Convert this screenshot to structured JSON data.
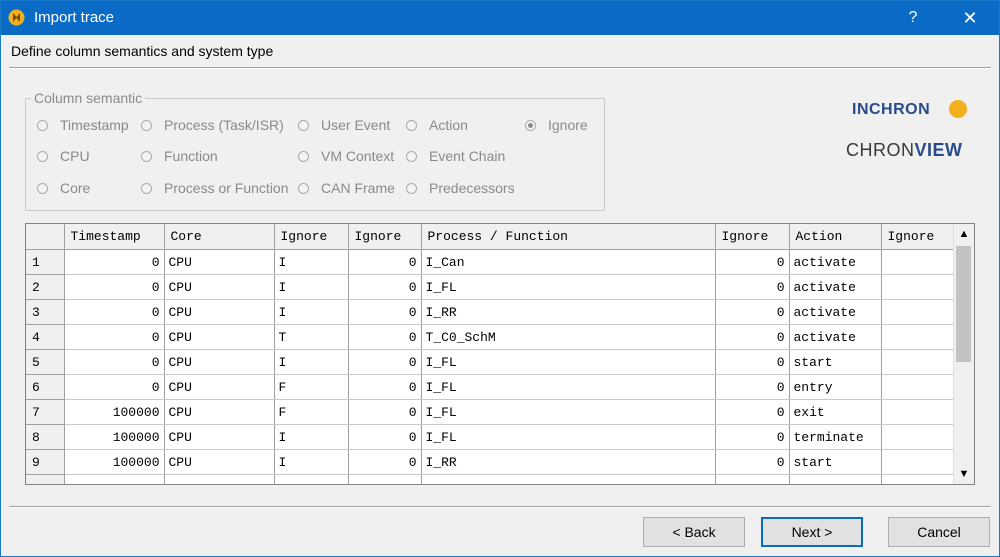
{
  "window": {
    "title": "Import trace",
    "help": "?",
    "close": "✕",
    "icon": "inchron-app-icon"
  },
  "subtitle": "Define column semantics and system type",
  "column_semantic": {
    "legend": "Column semantic",
    "options": [
      {
        "label": "Timestamp",
        "checked": false
      },
      {
        "label": "Process (Task/ISR)",
        "checked": false
      },
      {
        "label": "User Event",
        "checked": false
      },
      {
        "label": "Action",
        "checked": false
      },
      {
        "label": "Ignore",
        "checked": true
      },
      {
        "label": "CPU",
        "checked": false
      },
      {
        "label": "Function",
        "checked": false
      },
      {
        "label": "VM Context",
        "checked": false
      },
      {
        "label": "Event Chain",
        "checked": false
      },
      {
        "label": "Core",
        "checked": false
      },
      {
        "label": "Process or Function",
        "checked": false
      },
      {
        "label": "CAN Frame",
        "checked": false
      },
      {
        "label": "Predecessors",
        "checked": false
      }
    ]
  },
  "logos": {
    "inchron": "INCHRON",
    "chron": "CHRON",
    "view": "VIEW",
    "brand_color": "#2a4a8a",
    "mark_color": "#f2b01e"
  },
  "table": {
    "headers": [
      "Timestamp",
      "Core",
      "Ignore",
      "Ignore",
      "Process / Function",
      "Ignore",
      "Action",
      "Ignore"
    ],
    "rows": [
      [
        "1",
        "0",
        "CPU",
        "I",
        "0",
        "I_Can",
        "0",
        "activate",
        ""
      ],
      [
        "2",
        "0",
        "CPU",
        "I",
        "0",
        "I_FL",
        "0",
        "activate",
        ""
      ],
      [
        "3",
        "0",
        "CPU",
        "I",
        "0",
        "I_RR",
        "0",
        "activate",
        ""
      ],
      [
        "4",
        "0",
        "CPU",
        "T",
        "0",
        "T_C0_SchM",
        "0",
        "activate",
        ""
      ],
      [
        "5",
        "0",
        "CPU",
        "I",
        "0",
        "I_FL",
        "0",
        "start",
        ""
      ],
      [
        "6",
        "0",
        "CPU",
        "F",
        "0",
        "I_FL",
        "0",
        "entry",
        ""
      ],
      [
        "7",
        "100000",
        "CPU",
        "F",
        "0",
        "I_FL",
        "0",
        "exit",
        ""
      ],
      [
        "8",
        "100000",
        "CPU",
        "I",
        "0",
        "I_FL",
        "0",
        "terminate",
        ""
      ],
      [
        "9",
        "100000",
        "CPU",
        "I",
        "0",
        "I_RR",
        "0",
        "start",
        ""
      ],
      [
        "",
        "",
        "",
        "",
        "",
        "",
        "",
        "",
        ""
      ]
    ],
    "scroll_up": "▲",
    "scroll_down": "▼"
  },
  "buttons": {
    "back": "< Back",
    "next": "Next >",
    "cancel": "Cancel"
  },
  "colors": {
    "titlebar": "#0a6bc7",
    "default_button_border": "#0a6bc7"
  }
}
